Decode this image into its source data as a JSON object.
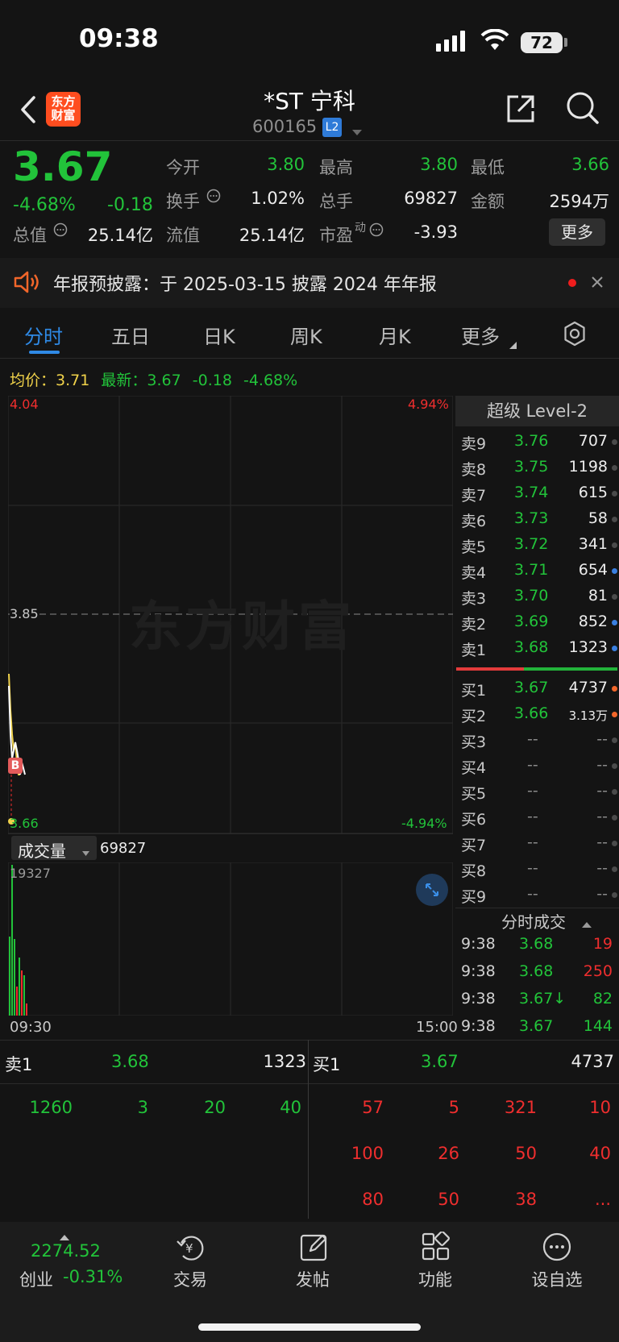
{
  "status_bar": {
    "time": "09:38",
    "battery": "72"
  },
  "header": {
    "stock_name": "*ST 宁科",
    "stock_code": "600165",
    "badge": "L2",
    "logo_line1": "东方",
    "logo_line2": "财富"
  },
  "quote": {
    "price": "3.67",
    "change_pct": "-4.68%",
    "change": "-0.18",
    "open_label": "今开",
    "open": "3.80",
    "high_label": "最高",
    "high": "3.80",
    "low_label": "最低",
    "low": "3.66",
    "turnover_label": "换手",
    "turnover": "1.02%",
    "volume_label": "总手",
    "volume": "69827",
    "amount_label": "金额",
    "amount": "2594万",
    "mktcap_label": "总值",
    "mktcap": "25.14亿",
    "float_label": "流值",
    "float_cap": "25.14亿",
    "pe_label": "市盈",
    "pe_sup": "动",
    "pe": "-3.93",
    "more_label": "更多"
  },
  "notice": {
    "text": "年报预披露：于 2025-03-15 披露 2024 年年报"
  },
  "tabs": [
    "分时",
    "五日",
    "日K",
    "周K",
    "月K",
    "更多"
  ],
  "avg_line": {
    "avg_label": "均价：",
    "avg": "3.71",
    "latest_label": "最新：",
    "latest": "3.67",
    "change": "-0.18",
    "change_pct": "-4.68%"
  },
  "chart": {
    "top_price": "4.04",
    "top_pct": "4.94%",
    "mid_price": "3.85",
    "bottom_price": "3.66",
    "bottom_pct": "-4.94%",
    "watermark": "东方财富",
    "marker": "B"
  },
  "volume": {
    "label": "成交量",
    "value": "69827",
    "max": "19327",
    "start_time": "09:30",
    "end_time": "15:00"
  },
  "order_book": {
    "title": "超级 Level-2",
    "asks": [
      {
        "label": "卖9",
        "price": "3.76",
        "vol": "707",
        "dot": "#4a4a4a"
      },
      {
        "label": "卖8",
        "price": "3.75",
        "vol": "1198",
        "dot": "#4a4a4a"
      },
      {
        "label": "卖7",
        "price": "3.74",
        "vol": "615",
        "dot": "#4a4a4a"
      },
      {
        "label": "卖6",
        "price": "3.73",
        "vol": "58",
        "dot": "#4a4a4a"
      },
      {
        "label": "卖5",
        "price": "3.72",
        "vol": "341",
        "dot": "#4a4a4a"
      },
      {
        "label": "卖4",
        "price": "3.71",
        "vol": "654",
        "dot": "#3a7fe0"
      },
      {
        "label": "卖3",
        "price": "3.70",
        "vol": "81",
        "dot": "#4a4a4a"
      },
      {
        "label": "卖2",
        "price": "3.69",
        "vol": "852",
        "dot": "#3a7fe0"
      },
      {
        "label": "卖1",
        "price": "3.68",
        "vol": "1323",
        "dot": "#3a7fe0"
      }
    ],
    "bids": [
      {
        "label": "买1",
        "price": "3.67",
        "vol": "4737",
        "dot": "#f2662a"
      },
      {
        "label": "买2",
        "price": "3.66",
        "vol": "3.13万",
        "dot": "#f2662a"
      },
      {
        "label": "买3",
        "price": "--",
        "vol": "--",
        "dot": "#4a4a4a"
      },
      {
        "label": "买4",
        "price": "--",
        "vol": "--",
        "dot": "#4a4a4a"
      },
      {
        "label": "买5",
        "price": "--",
        "vol": "--",
        "dot": "#4a4a4a"
      },
      {
        "label": "买6",
        "price": "--",
        "vol": "--",
        "dot": "#4a4a4a"
      },
      {
        "label": "买7",
        "price": "--",
        "vol": "--",
        "dot": "#4a4a4a"
      },
      {
        "label": "买8",
        "price": "--",
        "vol": "--",
        "dot": "#4a4a4a"
      },
      {
        "label": "买9",
        "price": "--",
        "vol": "--",
        "dot": "#4a4a4a"
      }
    ]
  },
  "tick_trades": {
    "title": "分时成交",
    "rows": [
      {
        "time": "9:38",
        "price": "3.68",
        "vol": "19",
        "price_color": "green",
        "vol_color": "red"
      },
      {
        "time": "9:38",
        "price": "3.68",
        "vol": "250",
        "price_color": "green",
        "vol_color": "red"
      },
      {
        "time": "9:38",
        "price": "3.67↓",
        "vol": "82",
        "price_color": "green",
        "vol_color": "green"
      },
      {
        "time": "9:38",
        "price": "3.67",
        "vol": "144",
        "price_color": "green",
        "vol_color": "green"
      }
    ]
  },
  "level_table": {
    "sell_label": "卖1",
    "sell_price": "3.68",
    "sell_vol": "1323",
    "buy_label": "买1",
    "buy_price": "3.67",
    "buy_vol": "4737",
    "sell_queue": [
      "1260",
      "3",
      "20",
      "40"
    ],
    "buy_queue": [
      [
        "57",
        "5",
        "321",
        "10"
      ],
      [
        "100",
        "26",
        "50",
        "40"
      ],
      [
        "80",
        "50",
        "38",
        "..."
      ]
    ]
  },
  "bottom_nav": {
    "index_value": "2274.52",
    "index_name": "创业",
    "index_change": "-0.31%",
    "items": [
      "交易",
      "发帖",
      "功能",
      "设自选"
    ]
  },
  "colors": {
    "up": "#ef2e2e",
    "down": "#22c33a",
    "accent": "#2f8ae6",
    "bg": "#141414"
  }
}
